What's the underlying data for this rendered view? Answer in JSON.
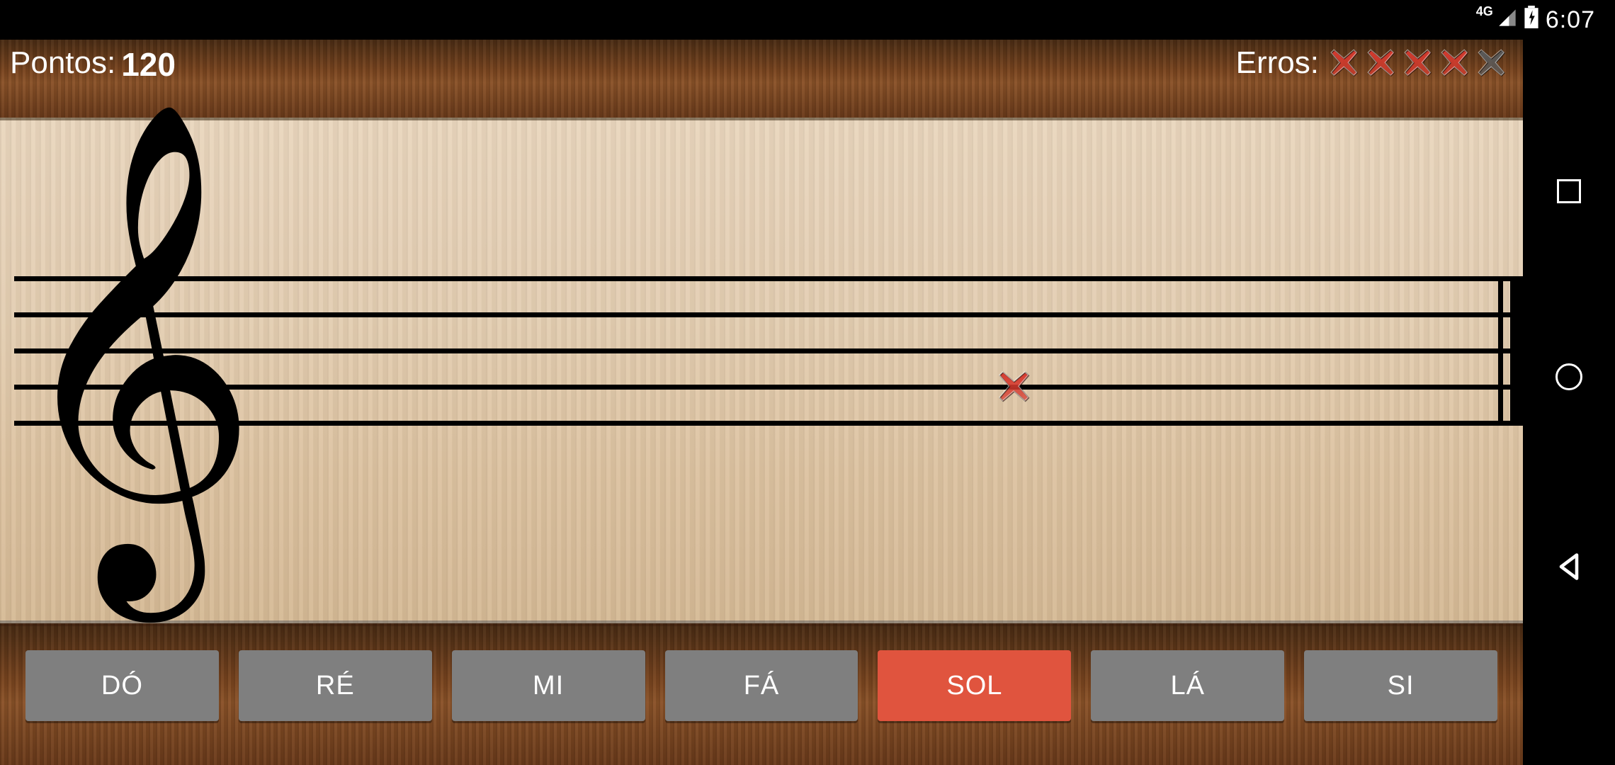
{
  "status": {
    "network": "4G",
    "time": "6:07"
  },
  "hud": {
    "score_label": "Pontos:",
    "score_value": "120",
    "errors_label": "Erros:",
    "errors_used": 4,
    "errors_total": 5
  },
  "staff": {
    "clef_glyph": "𝄞",
    "note_marker": {
      "x_percent": 65,
      "line_index_from_top": 3,
      "glyph": "x"
    }
  },
  "answers": {
    "buttons": [
      {
        "label": "DÓ",
        "selected": false
      },
      {
        "label": "RÉ",
        "selected": false
      },
      {
        "label": "MI",
        "selected": false
      },
      {
        "label": "FÁ",
        "selected": false
      },
      {
        "label": "SOL",
        "selected": true
      },
      {
        "label": "LÁ",
        "selected": false
      },
      {
        "label": "SI",
        "selected": false
      }
    ]
  },
  "colors": {
    "x_red": "#d63a2e",
    "x_grey": "#5a5a5a",
    "btn_selected": "#e0543e"
  }
}
